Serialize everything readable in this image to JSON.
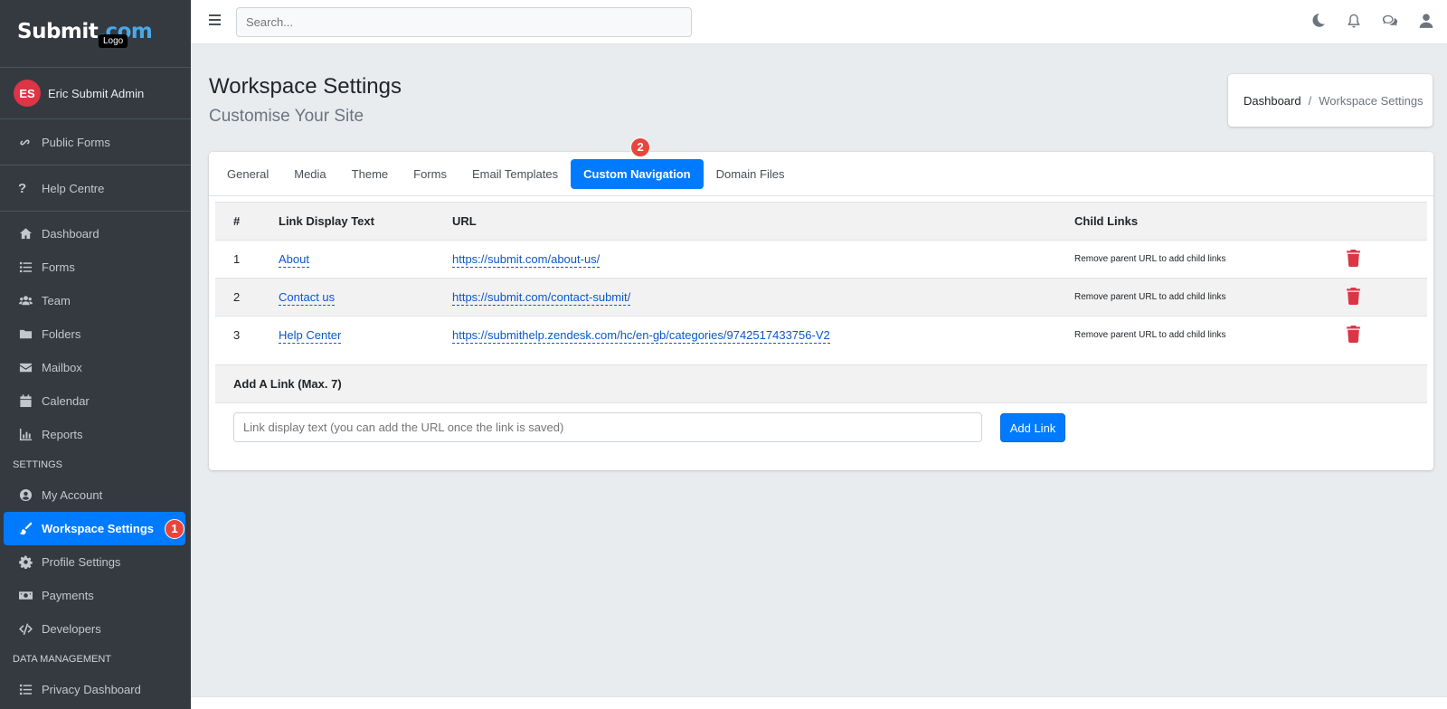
{
  "brand": {
    "logo_text": "Submit",
    "logo_dot": ".com",
    "tooltip": "Logo"
  },
  "user": {
    "initials": "ES",
    "name": "Eric Submit Admin"
  },
  "sidebar": {
    "public_forms": "Public Forms",
    "help_centre": "Help Centre",
    "items": [
      {
        "label": "Dashboard",
        "icon": "home-icon"
      },
      {
        "label": "Forms",
        "icon": "list-icon"
      },
      {
        "label": "Team",
        "icon": "users-icon"
      },
      {
        "label": "Folders",
        "icon": "folder-icon"
      },
      {
        "label": "Mailbox",
        "icon": "envelope-icon"
      },
      {
        "label": "Calendar",
        "icon": "calendar-icon"
      },
      {
        "label": "Reports",
        "icon": "chart-icon"
      }
    ],
    "settings_header": "SETTINGS",
    "settings_items": [
      {
        "label": "My Account",
        "icon": "user-circle-icon"
      },
      {
        "label": "Workspace Settings",
        "icon": "brush-icon",
        "badge": "1"
      },
      {
        "label": "Profile Settings",
        "icon": "gear-icon"
      },
      {
        "label": "Payments",
        "icon": "money-icon"
      },
      {
        "label": "Developers",
        "icon": "code-icon"
      }
    ],
    "data_header": "DATA MANAGEMENT",
    "data_items": [
      {
        "label": "Privacy Dashboard",
        "icon": "list-icon"
      }
    ]
  },
  "topbar": {
    "search_placeholder": "Search..."
  },
  "page": {
    "title": "Workspace Settings",
    "subtitle": "Customise Your Site"
  },
  "breadcrumb": {
    "home": "Dashboard",
    "separator": "/",
    "current": "Workspace Settings"
  },
  "tabs": {
    "items": [
      "General",
      "Media",
      "Theme",
      "Forms",
      "Email Templates",
      "Custom Navigation",
      "Domain Files"
    ],
    "active_badge": "2"
  },
  "table": {
    "headers": [
      "#",
      "Link Display Text",
      "URL",
      "Child Links"
    ],
    "rows": [
      {
        "num": "1",
        "text": "About",
        "url": "https://submit.com/about-us/",
        "child": "Remove parent URL to add child links"
      },
      {
        "num": "2",
        "text": "Contact us",
        "url": "https://submit.com/contact-submit/",
        "child": "Remove parent URL to add child links"
      },
      {
        "num": "3",
        "text": "Help Center",
        "url": "https://submithelp.zendesk.com/hc/en-gb/categories/9742517433756-V2",
        "child": "Remove parent URL to add child links"
      }
    ]
  },
  "add_link": {
    "header": "Add A Link (Max. 7)",
    "placeholder": "Link display text (you can add the URL once the link is saved)",
    "button": "Add Link"
  }
}
